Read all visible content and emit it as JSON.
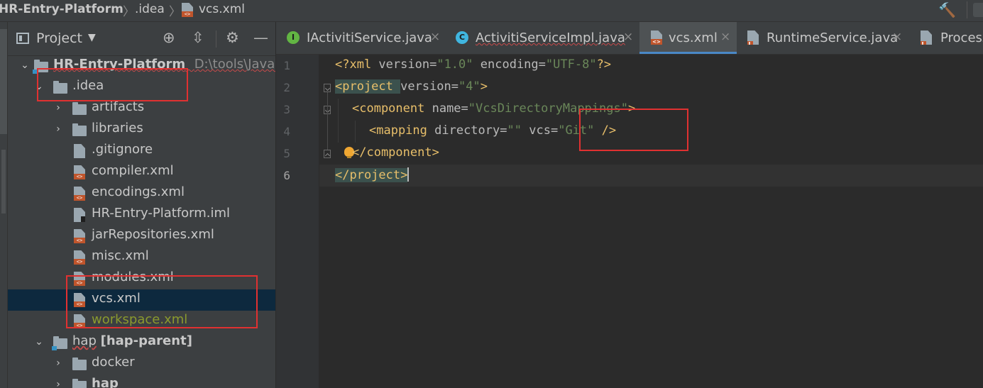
{
  "breadcrumb": {
    "root": "HR-Entry-Platform",
    "folder": ".idea",
    "file": "vcs.xml"
  },
  "project_panel": {
    "title": "Project",
    "tree": [
      {
        "label": "HR-Entry-Platform",
        "path": "D:\\tools\\JavaWo",
        "type": "module",
        "expanded": true
      },
      {
        "label": ".idea",
        "type": "folder",
        "expanded": true
      },
      {
        "label": "artifacts",
        "type": "folder",
        "expanded": false
      },
      {
        "label": "libraries",
        "type": "folder",
        "expanded": false
      },
      {
        "label": ".gitignore",
        "type": "file"
      },
      {
        "label": "compiler.xml",
        "type": "xml"
      },
      {
        "label": "encodings.xml",
        "type": "xml"
      },
      {
        "label": "HR-Entry-Platform.iml",
        "type": "iml"
      },
      {
        "label": "jarRepositories.xml",
        "type": "xml"
      },
      {
        "label": "misc.xml",
        "type": "xml"
      },
      {
        "label": "modules.xml",
        "type": "xml"
      },
      {
        "label": "vcs.xml",
        "type": "xml",
        "selected": true
      },
      {
        "label": "workspace.xml",
        "type": "xml",
        "status": "modified-yellow"
      },
      {
        "label": "hap",
        "module_tag": "[hap-parent]",
        "type": "module",
        "expanded": true
      },
      {
        "label": "docker",
        "type": "folder",
        "expanded": false
      },
      {
        "label": "hap",
        "type": "folder",
        "expanded": false
      }
    ]
  },
  "editor_tabs": [
    {
      "label": "IActivitiService.java",
      "icon": "interface-icon",
      "close": "×"
    },
    {
      "label": "ActivitiServiceImpl.java",
      "icon": "class-icon",
      "close": "×"
    },
    {
      "label": "vcs.xml",
      "icon": "xml-file-icon",
      "close": "×",
      "active": true
    },
    {
      "label": "RuntimeService.java",
      "icon": "java-file-icon",
      "close": "×"
    },
    {
      "label": "Process",
      "icon": "java-file-icon"
    }
  ],
  "editor": {
    "line_numbers": [
      "1",
      "2",
      "3",
      "4",
      "5",
      "6"
    ],
    "lines": {
      "l1": {
        "a": "<?xml ",
        "b": "version",
        "c": "=",
        "d": "\"1.0\"",
        "e": " ",
        "f": "encoding",
        "g": "=",
        "h": "\"UTF-8\"",
        "i": "?>"
      },
      "l2": {
        "a": "<project ",
        "b": "version",
        "c": "=",
        "d": "\"4\"",
        "e": ">"
      },
      "l3": {
        "a": "<component ",
        "b": "name",
        "c": "=",
        "d": "\"VcsDirectoryMappings\"",
        "e": ">"
      },
      "l4": {
        "a": "<mapping ",
        "b": "directory",
        "c": "=",
        "d": "\"\"",
        "e": " ",
        "f": "vcs",
        "g": "=",
        "h": "\"Git\"",
        "i": " />"
      },
      "l5": {
        "a": "</component>"
      },
      "l6": {
        "a": "</project>"
      }
    }
  },
  "colors": {
    "annotation_red": "#e03131",
    "selection_blue": "#0d293e",
    "xml_tag": "#e8bf6a",
    "xml_value": "#6a8759"
  }
}
